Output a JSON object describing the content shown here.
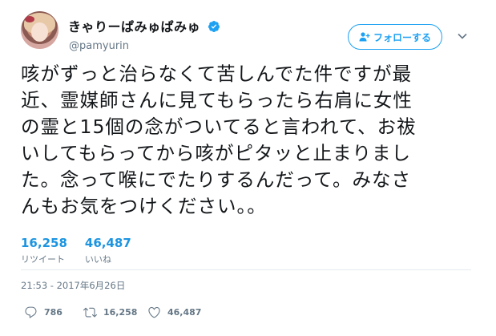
{
  "user": {
    "display_name": "きゃりーぱみゅぱみゅ",
    "username": "@pamyurin",
    "verified": true
  },
  "follow_button": {
    "label": "フォローする"
  },
  "tweet": {
    "lines": [
      "咳がずっと治らなくて苦しんでた件ですが最",
      "近、霊媒師さんに見てもらったら右肩に女性",
      "の霊と15個の念がついてると言われて、お祓",
      "いしてもらってから咳がピタッと止まりまし",
      "た。念って喉にでたりするんだって。みなさ",
      "んもお気をつけください。。"
    ]
  },
  "stats": {
    "retweets": {
      "value": "16,258",
      "label": "リツイート"
    },
    "likes": {
      "value": "46,487",
      "label": "いいね"
    }
  },
  "timestamp": "21:53 - 2017年6月26日",
  "actions": {
    "reply_count": "786",
    "retweet_count": "16,258",
    "like_count": "46,487"
  },
  "colors": {
    "accent": "#1da1f2",
    "stat_value": "#1c94e0",
    "muted": "#657786"
  }
}
